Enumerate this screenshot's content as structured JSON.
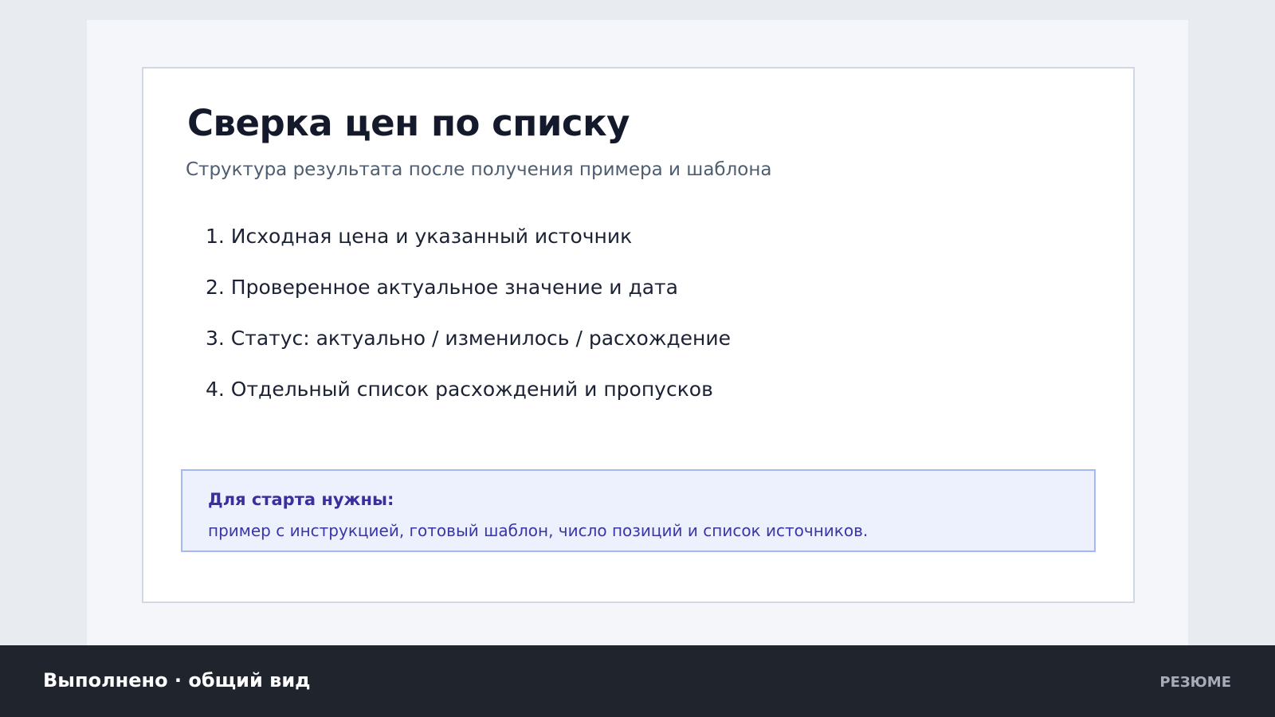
{
  "slide": {
    "title": "Сверка цен по списку",
    "subtitle": "Структура результата после получения примера и шаблона",
    "steps": [
      "1. Исходная цена и указанный источник",
      "2. Проверенное актуальное значение и дата",
      "3. Статус: актуально / изменилось / расхождение",
      "4. Отдельный список расхождений и пропусков"
    ],
    "note": {
      "title": "Для старта нужны:",
      "text": "пример с инструкцией, готовый шаблон, число позиций и список источников."
    }
  },
  "footer": {
    "title": "Выполнено · общий вид",
    "tag": "РЕЗЮМЕ"
  },
  "colors": {
    "page_background": "#e8ebef",
    "card_background": "#ffffff",
    "note_background": "#ecf1fd",
    "note_accent": "#3b2fa0",
    "footer_background": "#20242d"
  }
}
